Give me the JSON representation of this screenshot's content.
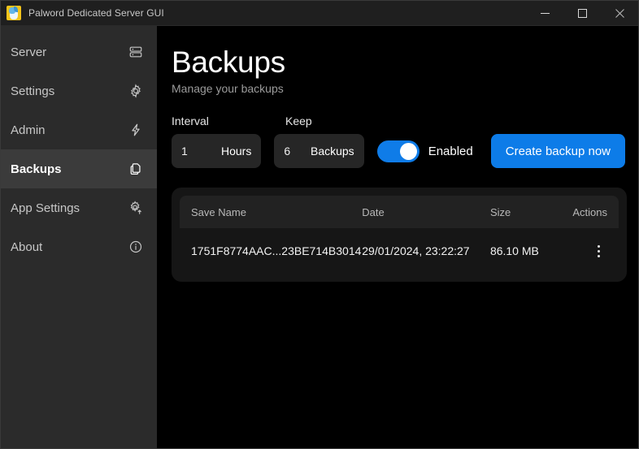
{
  "titlebar": {
    "app_icon": "palworld-app-icon",
    "title": "Palword Dedicated Server GUI",
    "controls": {
      "minimize": "minimize-icon",
      "maximize": "maximize-icon",
      "close": "close-icon"
    }
  },
  "sidebar": {
    "items": [
      {
        "label": "Server",
        "icon": "server-icon",
        "active": false
      },
      {
        "label": "Settings",
        "icon": "gear-icon",
        "active": false
      },
      {
        "label": "Admin",
        "icon": "lightning-bolt-icon",
        "active": false
      },
      {
        "label": "Backups",
        "icon": "copy-icon",
        "active": true
      },
      {
        "label": "App Settings",
        "icon": "gear-upload-icon",
        "active": false
      },
      {
        "label": "About",
        "icon": "info-circle-icon",
        "active": false
      }
    ]
  },
  "main": {
    "title": "Backups",
    "subtitle": "Manage your backups",
    "controls": {
      "interval_label": "Interval",
      "interval_value": "1",
      "interval_suffix": "Hours",
      "keep_label": "Keep",
      "keep_value": "6",
      "keep_suffix": "Backups",
      "toggle_state": "on",
      "toggle_label": "Enabled",
      "create_button": "Create backup now"
    },
    "table": {
      "columns": [
        "Save Name",
        "Date",
        "Size",
        "Actions"
      ],
      "rows": [
        {
          "save_name": "1751F8774AAC...23BE714B3014",
          "date": "29/01/2024, 23:22:27",
          "size": "86.10 MB",
          "actions": "kebab-menu-icon"
        }
      ]
    }
  },
  "colors": {
    "accent": "#0d7ce8",
    "sidebar_bg": "#2b2b2b",
    "sidebar_active_bg": "#3b3b3b",
    "main_bg": "#000000",
    "card_bg": "#161616",
    "titlebar_bg": "#1f1f1f"
  }
}
